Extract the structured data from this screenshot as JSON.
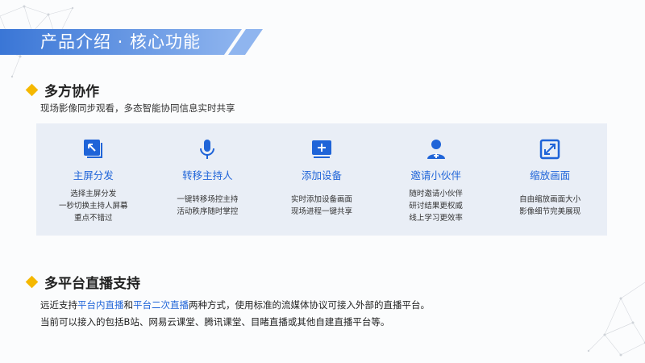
{
  "header": {
    "title": "产品介绍 · 核心功能"
  },
  "section1": {
    "title": "多方协作",
    "subtitle": "现场影像同步观看，多态智能协同信息实时共享",
    "features": [
      {
        "icon": "screen-share-icon",
        "name": "主屏分发",
        "lines": [
          "选择主屏分发",
          "一秒切换主持人屏幕",
          "重点不错过"
        ]
      },
      {
        "icon": "microphone-icon",
        "name": "转移主持人",
        "lines": [
          "一键转移场控主持",
          "活动秩序随时掌控"
        ]
      },
      {
        "icon": "add-device-icon",
        "name": "添加设备",
        "lines": [
          "实时添加设备画面",
          "现场进程一键共享"
        ]
      },
      {
        "icon": "add-person-icon",
        "name": "邀请小伙伴",
        "lines": [
          "随时邀请小伙伴",
          "研讨结果更权威",
          "线上学习更效率"
        ]
      },
      {
        "icon": "scale-screen-icon",
        "name": "缩放画面",
        "lines": [
          "自由缩放画面大小",
          "影像细节完美展现"
        ]
      }
    ]
  },
  "section2": {
    "title": "多平台直播支持",
    "para1": {
      "prefix": "远近支持",
      "highlight1": "平台内直播",
      "mid": "和",
      "highlight2": "平台二次直播",
      "suffix": "两种方式，使用标准的流媒体协议可接入外部的直播平台。"
    },
    "para2": "当前可以接入的包括B站、网易云课堂、腾讯课堂、目睹直播或其他自建直播平台等。"
  },
  "colors": {
    "accent": "#1f64d8",
    "diamond": "#f5b800",
    "panel": "#e9eef6",
    "banner": "#4c86dc"
  }
}
